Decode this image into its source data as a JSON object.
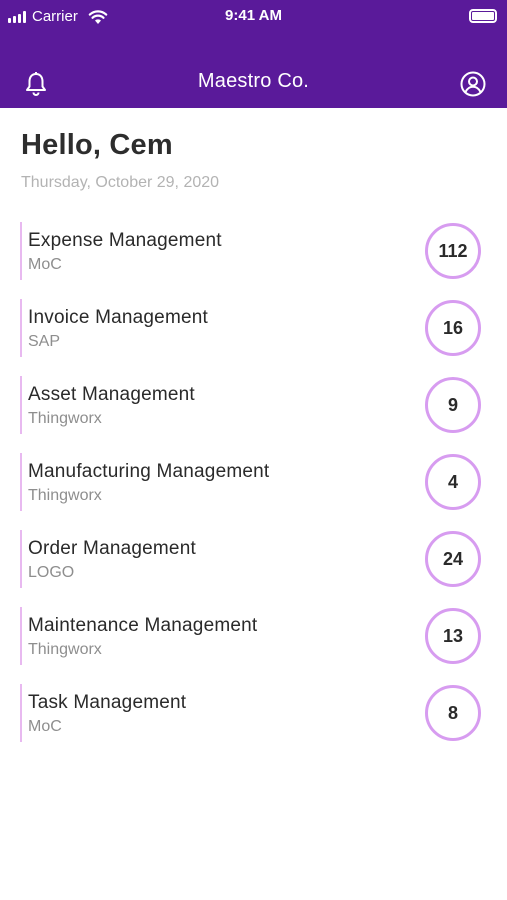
{
  "status_bar": {
    "carrier": "Carrier",
    "time": "9:41 AM",
    "icons": [
      "signal-icon",
      "wifi-icon",
      "battery-icon"
    ]
  },
  "nav": {
    "title": "Maestro Co.",
    "left_icon": "bell-icon",
    "right_icon": "profile-icon"
  },
  "greeting": "Hello, Cem",
  "date": "Thursday, October 29, 2020",
  "colors": {
    "primary": "#5a1a9a",
    "accent": "#d79cf0",
    "row_bar": "#e8b9f0"
  },
  "items": [
    {
      "title": "Expense Management",
      "subtitle": "MoC",
      "count": "112"
    },
    {
      "title": "Invoice Management",
      "subtitle": "SAP",
      "count": "16"
    },
    {
      "title": "Asset Management",
      "subtitle": "Thingworx",
      "count": "9"
    },
    {
      "title": "Manufacturing Management",
      "subtitle": "Thingworx",
      "count": "4"
    },
    {
      "title": "Order Management",
      "subtitle": "LOGO",
      "count": "24"
    },
    {
      "title": "Maintenance Management",
      "subtitle": "Thingworx",
      "count": "13"
    },
    {
      "title": "Task Management",
      "subtitle": "MoC",
      "count": "8"
    }
  ]
}
